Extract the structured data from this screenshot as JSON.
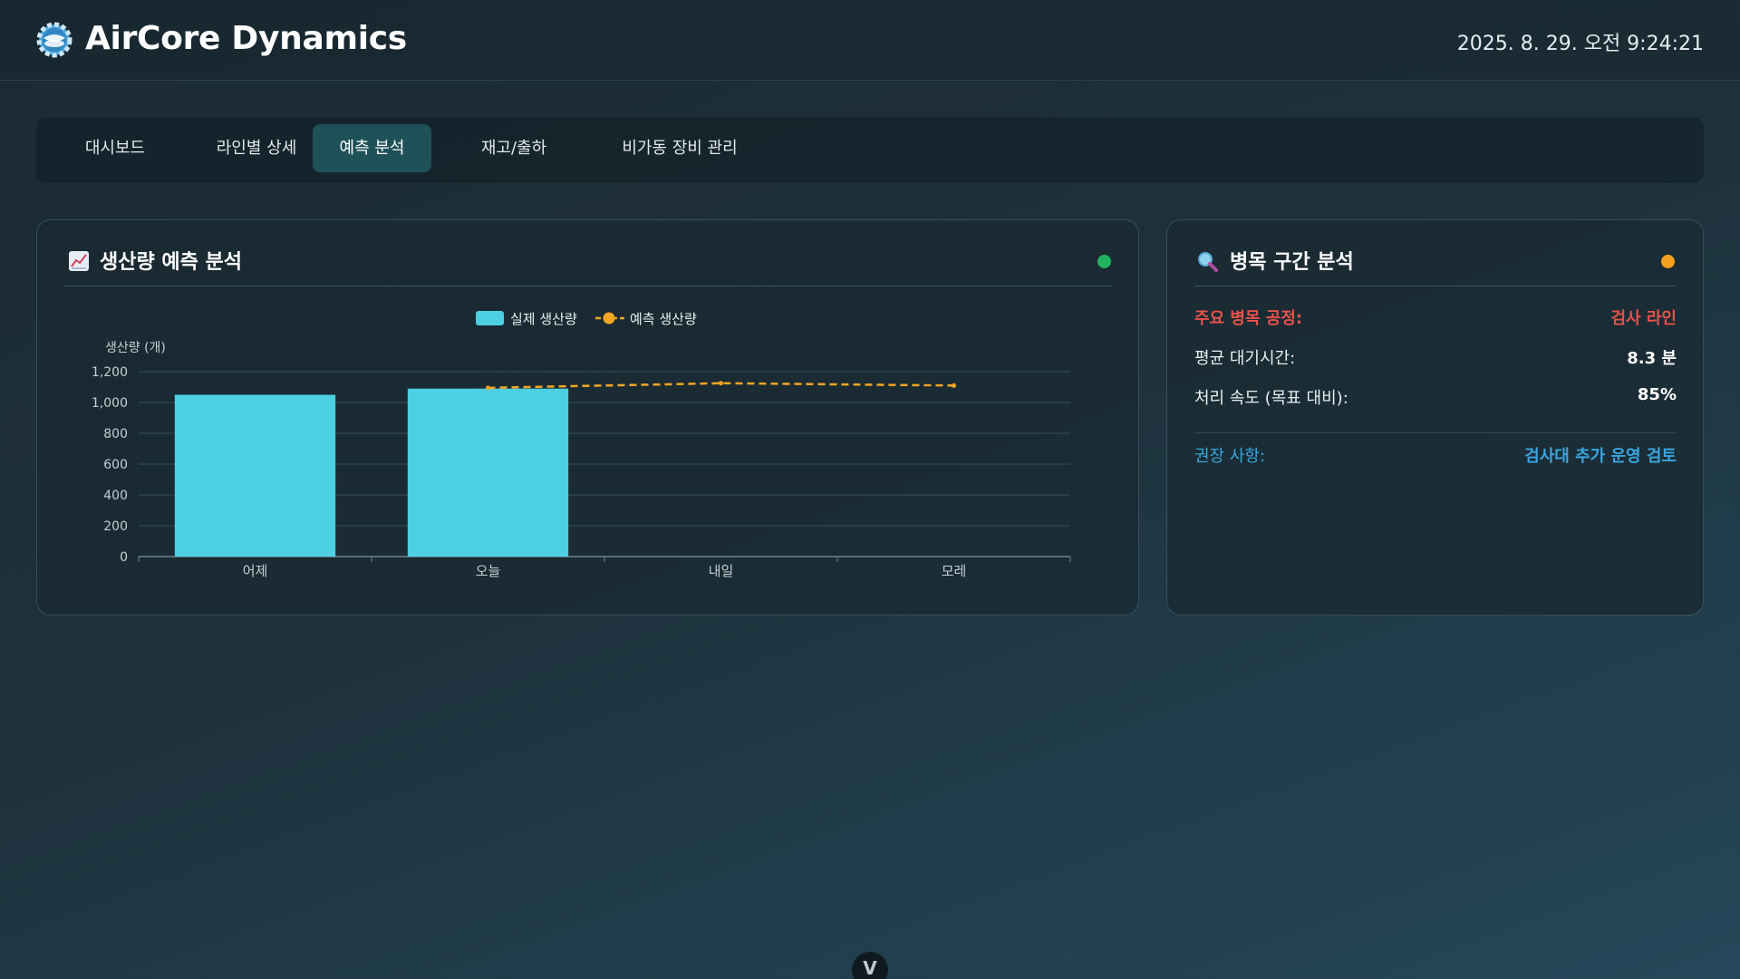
{
  "header": {
    "app_title": "AirCore Dynamics",
    "datetime": "2025. 8. 29. 오전 9:24:21",
    "logo_icon": "gear-globe-icon"
  },
  "nav": {
    "tabs": [
      {
        "label": "대시보드",
        "active": false
      },
      {
        "label": "라인별 상세",
        "active": false
      },
      {
        "label": "예측 분석",
        "active": true
      },
      {
        "label": "재고/출하",
        "active": false
      },
      {
        "label": "비가동 장비 관리",
        "active": false
      }
    ]
  },
  "forecast_card": {
    "title": "생산량 예측 분석",
    "title_icon": "chart-increasing-icon",
    "status_color": "#22b35e"
  },
  "chart_data": {
    "type": "bar",
    "categories": [
      "어제",
      "오늘",
      "내일",
      "모레"
    ],
    "series": [
      {
        "name": "실제 생산량",
        "type": "bar",
        "color": "#4dd0e1",
        "values": [
          1050,
          1090,
          null,
          null
        ]
      },
      {
        "name": "예측 생산량",
        "type": "line",
        "style": "dashed",
        "color": "#f5a623",
        "values": [
          null,
          1095,
          1125,
          1110
        ]
      }
    ],
    "ylabel": "생산량 (개)",
    "ylim": [
      0,
      1200
    ],
    "yticks": [
      "0",
      "200",
      "400",
      "600",
      "800",
      "1,000",
      "1,200"
    ],
    "ytick_values": [
      0,
      200,
      400,
      600,
      800,
      1000,
      1200
    ],
    "grid": true,
    "legend_position": "top-center"
  },
  "bottleneck_card": {
    "title": "병목 구간 분석",
    "title_icon": "magnifier-icon",
    "status_color": "#f5a01e",
    "rows": [
      {
        "label": "주요 병목 공정:",
        "value": "검사 라인",
        "color": "#e8514a"
      },
      {
        "label": "평균 대기시간:",
        "value": "8.3 분",
        "color": "#ffffff"
      },
      {
        "label": "처리 속도 (목표 대비):",
        "value": "85%",
        "color": "#ffffff"
      }
    ],
    "recommendation": {
      "label": "권장 사항:",
      "value": "검사대 추가 운영 검토",
      "color": "#3aa6e0"
    }
  },
  "scroll_button": {
    "glyph": "V"
  }
}
